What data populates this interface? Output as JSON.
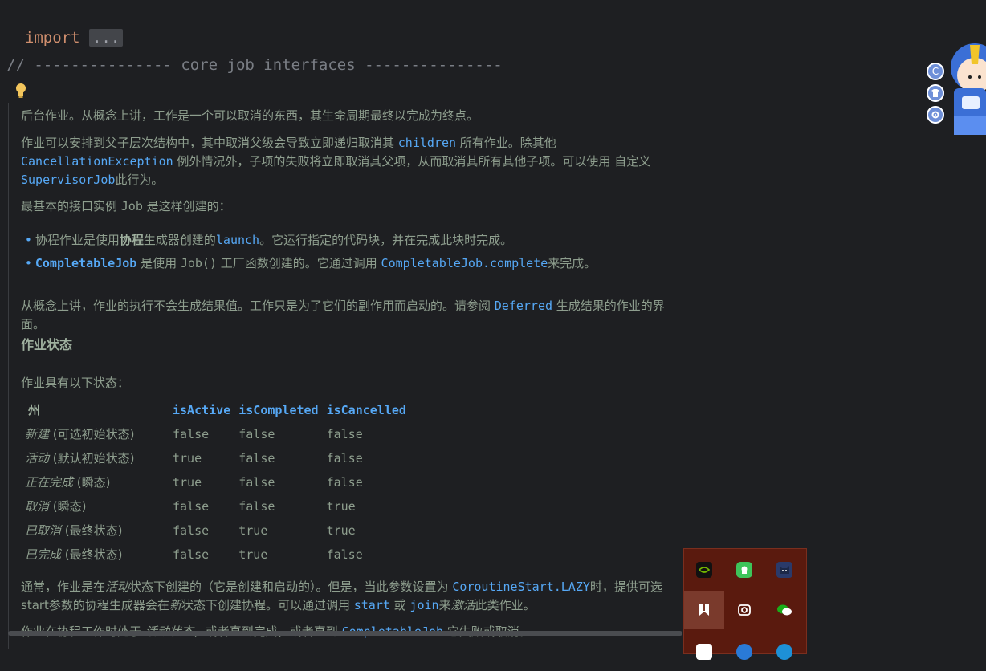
{
  "code": {
    "import_kw": "import",
    "import_fold": "...",
    "comment": "// --------------- core job interfaces ---------------"
  },
  "doc": {
    "p1": "后台作业。从概念上讲，工作是一个可以取消的东西，其生命周期最终以完成为终点。",
    "p2_a": "作业可以安排到父子层次结构中，其中取消父级会导致立即递归取消其 ",
    "p2_code1": "children",
    "p2_b": " 所有作业。除其他 ",
    "p2_code2": "CancellationException",
    "p2_c": " 例外情况外，子项的失败将立即取消其父项，从而取消其所有其他子项。可以使用 自定义 ",
    "p2_code3": "SupervisorJob",
    "p2_d": "此行为。",
    "p3_a": "最基本的接口实例 ",
    "p3_code": "Job",
    "p3_b": " 是这样创建的：",
    "b1_a": "协程作业是使用",
    "b1_bold": "协程",
    "b1_b": "生成器创建的",
    "b1_code": "launch",
    "b1_c": "。它运行指定的代码块，并在完成此块时完成。",
    "b2_code1": "CompletableJob",
    "b2_a": " 是使用 ",
    "b2_code2": "Job()",
    "b2_b": " 工厂函数创建的。它通过调用 ",
    "b2_code3": "CompletableJob.complete",
    "b2_c": "来完成。",
    "p4_a": "从概念上讲，作业的执行不会生成结果值。工作只是为了它们的副作用而启动的。请参阅 ",
    "p4_code": "Deferred",
    "p4_b": " 生成结果的作业的界面。",
    "heading": "作业状态",
    "p5": "作业具有以下状态：",
    "table": {
      "headers": [
        "州",
        "isActive",
        "isCompleted",
        "isCancelled"
      ],
      "rows": [
        {
          "state": "新建",
          "note": " (可选初始状态)",
          "a": "false",
          "c": "false",
          "x": "false"
        },
        {
          "state": "活动",
          "note": " (默认初始状态)",
          "a": "true",
          "c": "false",
          "x": "false"
        },
        {
          "state": "正在完成",
          "note": " (瞬态)",
          "a": "true",
          "c": "false",
          "x": "false"
        },
        {
          "state": "取消",
          "note": " (瞬态)",
          "a": "false",
          "c": "false",
          "x": "true"
        },
        {
          "state": "已取消",
          "note": " (最终状态)",
          "a": "false",
          "c": "true",
          "x": "true"
        },
        {
          "state": "已完成",
          "note": " (最终状态)",
          "a": "false",
          "c": "true",
          "x": "false"
        }
      ]
    },
    "p6_a": "通常，作业是在",
    "p6_it1": "活动",
    "p6_b": "状态下创建的（它是创建和启动的）。但是，当此参数设置为 ",
    "p6_code1": "CoroutineStart.LAZY",
    "p6_c": "时，提供可选",
    "p6_d": "start参数的协程生成器会在",
    "p6_it2": "新",
    "p6_e": "状态下创建协程。可以通过调用 ",
    "p6_code2": "start",
    "p6_f": " 或 ",
    "p6_code3": "join",
    "p6_g": "来",
    "p6_it3": "激活",
    "p6_h": "此类作业。",
    "p7_a": "作业在协程工作时处于 ",
    "p7_it": "活动状态",
    "p7_b": "，或者直到完成，或者直到 ",
    "p7_code": "CompletableJob",
    "p7_c": " 它失败或取消。"
  },
  "side_buttons": [
    "C",
    "shirt-icon",
    "gear-icon"
  ],
  "tray_icons": [
    {
      "name": "nvidia-icon",
      "color": "#76b900"
    },
    {
      "name": "app-green-icon",
      "color": "#3ec45a"
    },
    {
      "name": "cat-icon",
      "color": "#2a3a6a"
    },
    {
      "name": "bookmark-icon",
      "color": "#ffffff"
    },
    {
      "name": "capture-icon",
      "color": "#ffffff"
    },
    {
      "name": "wechat-icon",
      "color": "#1aad19"
    }
  ]
}
